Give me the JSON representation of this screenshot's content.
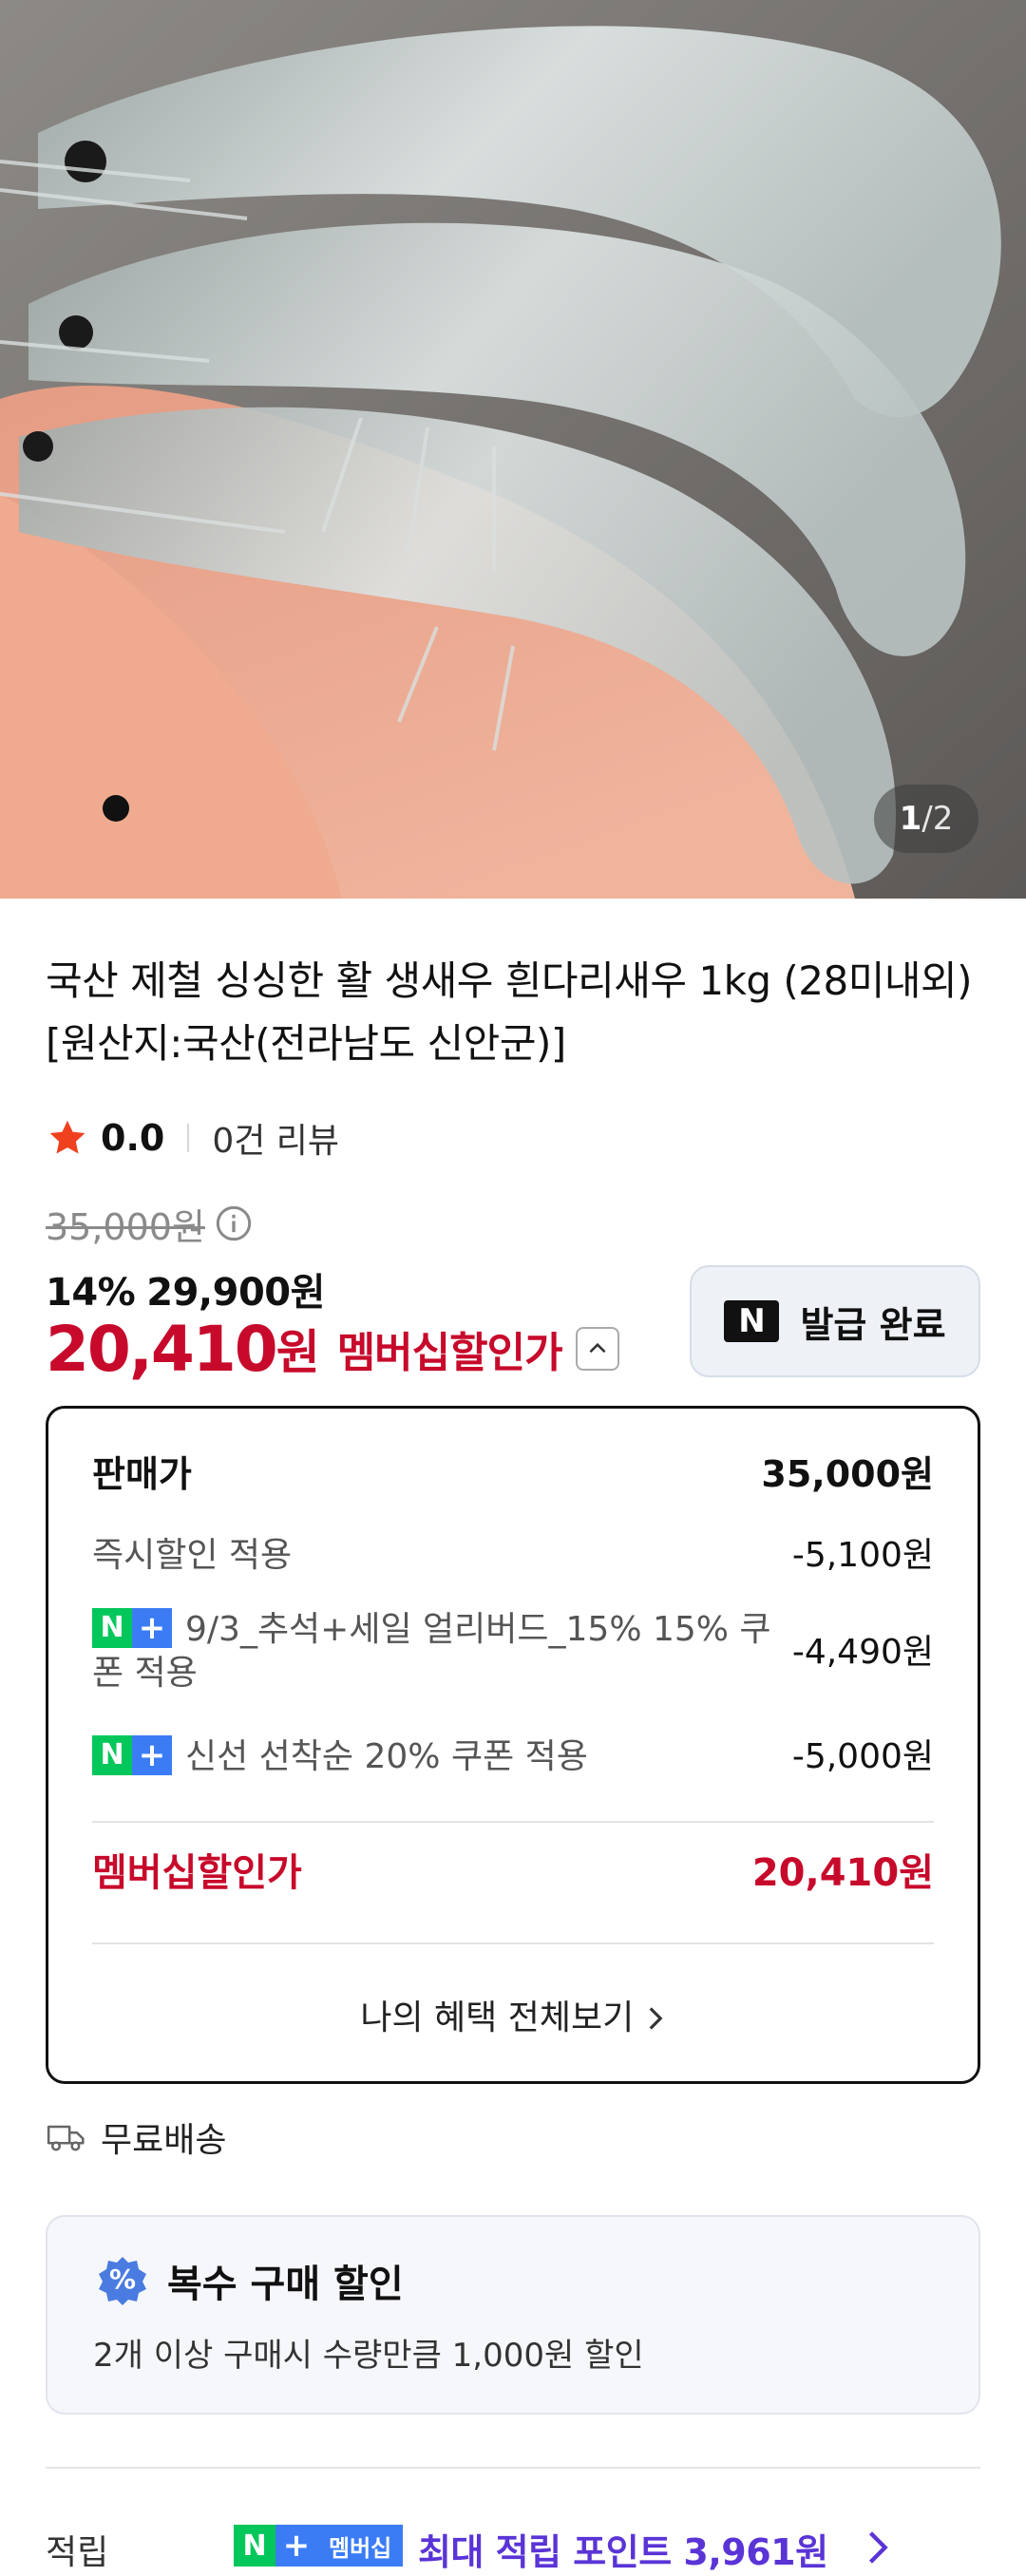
{
  "hero": {
    "image_alt": "fresh white-leg shrimp held in a hand",
    "counter_current": "1",
    "counter_separator": "/",
    "counter_total": "2"
  },
  "product": {
    "title": "국산 제철 싱싱한 활 생새우 흰다리새우 1kg (28미내외) [원산지:국산(전라남도 신안군)]",
    "rating": "0.0",
    "review_count": "0건 리뷰",
    "original_price": "35,000원",
    "discount_percent": "14%",
    "sale_price": "29,900원",
    "member_price_amount": "20,410",
    "member_price_unit": "원",
    "member_price_label": "멤버십할인가"
  },
  "coupon_button": {
    "label": "발급 완료",
    "logo": "N"
  },
  "breakdown": {
    "rows": [
      {
        "label": "판매가",
        "value": "35,000원"
      },
      {
        "label": "즉시할인 적용",
        "value": "-5,100원"
      },
      {
        "label": "9/3_추석+세일 얼리버드_15% 15% 쿠폰 적용",
        "value": "-4,490원"
      },
      {
        "label": "신선 선착순 20% 쿠폰 적용",
        "value": "-5,000원"
      }
    ],
    "total_label": "멤버십할인가",
    "total_value": "20,410원",
    "benefits_link": "나의 혜택 전체보기",
    "badge_n": "N",
    "badge_plus": "+"
  },
  "shipping": {
    "label": "무료배송"
  },
  "multi_purchase": {
    "title": "복수 구매 할인",
    "icon_text": "%",
    "description": "2개 이상 구매시 수량만큼 1,000원 할인"
  },
  "points": {
    "label": "적립",
    "badge_n": "N",
    "badge_plus": "+",
    "badge_member": "멤버십",
    "text": "최대 적립 포인트 3,961원"
  },
  "colors": {
    "accent_red": "#c70a2b",
    "naver_green": "#03c75a",
    "plus_blue": "#3b7cf5",
    "points_purple": "#5a34d6"
  }
}
